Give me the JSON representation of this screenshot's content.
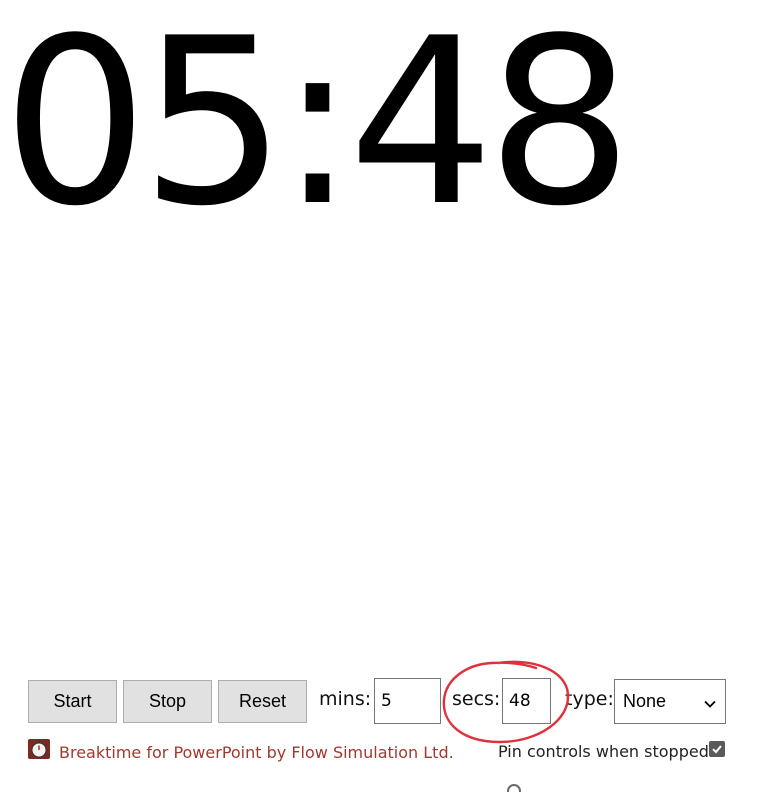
{
  "timer": {
    "display": "05:48"
  },
  "controls": {
    "start_label": "Start",
    "stop_label": "Stop",
    "reset_label": "Reset",
    "mins_label": "mins:",
    "mins_value": "5",
    "secs_label": "secs:",
    "secs_value": "48",
    "type_label": "type:",
    "type_selected": "None"
  },
  "footer": {
    "credit_text": "Breaktime for PowerPoint by Flow Simulation Ltd.",
    "pin_label": "Pin controls when stopped",
    "pin_checked": true
  },
  "colors": {
    "credit": "#a0392e",
    "highlight": "#e0313b",
    "button_bg": "#e1e1e1"
  },
  "icons": [
    "app-stopwatch-icon",
    "chevron-down-icon",
    "checkmark-icon"
  ]
}
